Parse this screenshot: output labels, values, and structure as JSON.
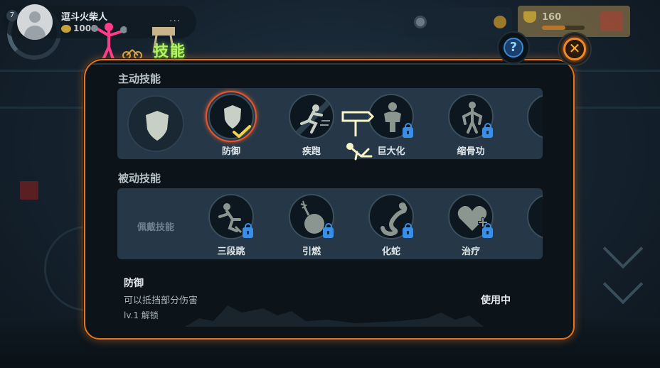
{
  "profile": {
    "level": "7",
    "name": "逗斗火柴人",
    "coins": "1000",
    "menu": "..."
  },
  "resources": {
    "trophy_value": "160",
    "trophy_progress": 0.55
  },
  "title": "技能",
  "help_label": "?",
  "close_label": "✕",
  "active_section": {
    "title": "主动技能",
    "skills": [
      {
        "label": "防御",
        "icon": "shield-icon",
        "selected": true,
        "locked": false
      },
      {
        "label": "疾跑",
        "icon": "sprint-icon",
        "selected": false,
        "locked": false
      },
      {
        "label": "巨大化",
        "icon": "giant-icon",
        "selected": false,
        "locked": true
      },
      {
        "label": "缩骨功",
        "icon": "shrink-icon",
        "selected": false,
        "locked": true
      }
    ]
  },
  "passive_section": {
    "title": "被动技能",
    "slot_label": "佩戴技能",
    "skills": [
      {
        "label": "三段跳",
        "icon": "triple-jump-icon",
        "locked": true
      },
      {
        "label": "引燃",
        "icon": "ignite-icon",
        "locked": true
      },
      {
        "label": "化蛇",
        "icon": "snake-icon",
        "locked": true
      },
      {
        "label": "治疗",
        "icon": "heal-icon",
        "locked": true
      }
    ]
  },
  "detail": {
    "name": "防御",
    "description": "可以抵挡部分伤害",
    "unlock": "lv.1 解锁",
    "status": "使用中"
  },
  "colors": {
    "panel_border": "#e6761f",
    "title_green": "#b6f266",
    "lock_blue": "#3a8ee6",
    "check_yellow": "#f2d24a",
    "selected_ring": "#e8562a"
  }
}
